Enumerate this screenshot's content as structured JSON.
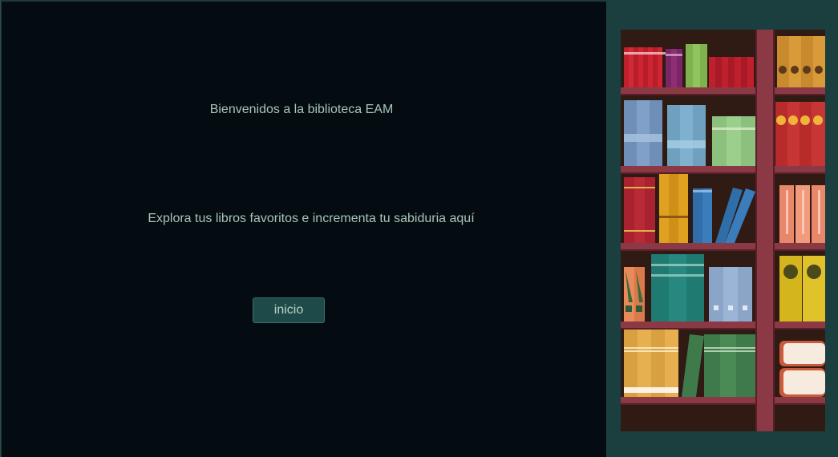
{
  "welcome_text": "Bienvenidos a la biblioteca EAM",
  "subtitle_text": "Explora tus libros favoritos e incrementa tu sabiduria aquí",
  "start_button_label": "inicio",
  "colors": {
    "background_dark": "#040c11",
    "side_panel": "#1b3f3e",
    "text": "#a9c4b6",
    "button_bg": "#1f4a4a",
    "shelf_wood": "#8b3a45",
    "shelf_back": "#2f1a14"
  }
}
